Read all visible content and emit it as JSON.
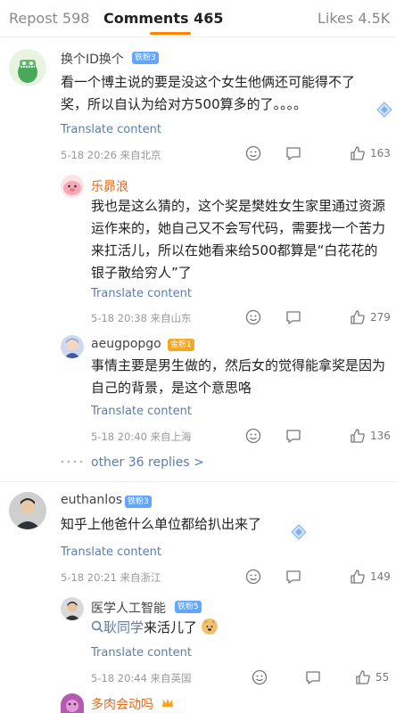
{
  "tabs": {
    "repost": "Repost 598",
    "comments": "Comments 465",
    "likes": "Likes 4.5K"
  },
  "comments": [
    {
      "username": "换个ID换个",
      "badge": "铁粉3",
      "text": "看一个博主说的要是没这个女生他俩还可能得不了奖，所以自认为给对方500算多的了。。。。",
      "translate": "Translate content",
      "meta": "5-18 20:26 来自北京",
      "likes": "163"
    },
    {
      "username": "乐昴浪",
      "text": "我也是这么猜的，这个奖是樊姓女生家里通过资源运作来的，她自己又不会写代码，需要找一个苦力来扛活儿，所以在她看来给500都算是“白花花的银子散给穷人”了",
      "translate": "Translate content",
      "meta": "5-18 20:38 来自山东",
      "likes": "279"
    },
    {
      "username": "aeugpopgo",
      "badge": "金粉1",
      "text": "事情主要是男生做的，然后女的觉得能拿奖是因为自己的背景，是这个意思咯",
      "translate": "Translate content",
      "meta": "5-18 20:40 来自上海",
      "likes": "136"
    },
    {
      "more_replies": "other 36 replies >"
    },
    {
      "username": "euthanlos",
      "badge": "铁粉3",
      "text": "知乎上他爸什么单位都给扒出来了",
      "translate": "Translate content",
      "meta": "5-18 20:21 来自浙江",
      "likes": "149"
    },
    {
      "username": "医学人工智能",
      "badge": "铁粉5",
      "mention": "耿同学",
      "text_after": "来活儿了",
      "translate": "Translate content",
      "meta": "5-18 20:44 来自英国",
      "likes": "55"
    },
    {
      "username": "多肉会动吗"
    }
  ]
}
